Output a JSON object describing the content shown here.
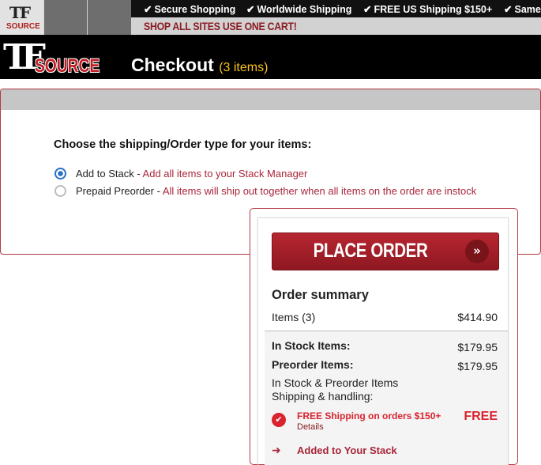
{
  "topbar": {
    "sites": [
      {
        "logo_t": "TF",
        "logo_sub": "SOURCE"
      },
      {},
      {}
    ],
    "promos": [
      "Secure Shopping",
      "Worldwide Shipping",
      "FREE US Shipping $150+",
      "Same"
    ],
    "shop_all": "SHOP ALL SITES  USE ONE CART!"
  },
  "header": {
    "logo_tf": "TF",
    "logo_source": "SOURCE",
    "title": "Checkout",
    "count": "(3 items)"
  },
  "shipping": {
    "question": "Choose the shipping/Order type for your items:",
    "options": [
      {
        "label": "Add to Stack - ",
        "desc": "Add all items to your Stack Manager",
        "selected": true
      },
      {
        "label": "Prepaid Preorder - ",
        "desc": "All items will ship out together when all items on the order are instock",
        "selected": false
      }
    ]
  },
  "summary": {
    "place_order": "PLACE ORDER",
    "place_order_arrow": "»",
    "title": "Order summary",
    "items_label": "Items (3)",
    "items_value": "$414.90",
    "instock_label": "In Stock Items:",
    "instock_value": "$179.95",
    "preorder_label": "Preorder Items:",
    "preorder_value": "$179.95",
    "shipping_line1": "In Stock & Preorder Items",
    "shipping_line2": "Shipping & handling:",
    "free_text": "FREE Shipping on orders $150+",
    "free_details": "Details",
    "free_value": "FREE",
    "added": "Added to Your Stack"
  },
  "colors": {
    "brand_red": "#8b1c23",
    "accent_yellow": "#f7c21c",
    "radio_blue": "#2a6fc9"
  }
}
